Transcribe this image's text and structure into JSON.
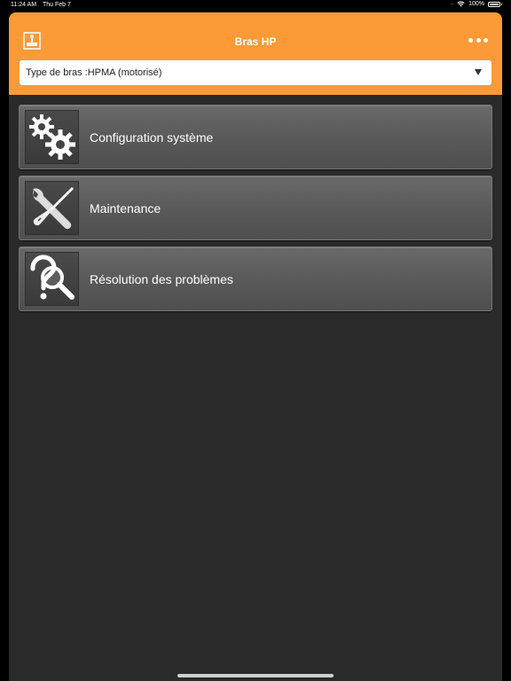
{
  "status_bar": {
    "time": "11:24 AM",
    "date": "Thu Feb 7",
    "battery": "100%"
  },
  "header": {
    "title": "Bras HP",
    "background_color": "#fb9a37"
  },
  "arm_type_select": {
    "value": "Type de bras :HPMA (motorisé)"
  },
  "menu": {
    "items": [
      {
        "label": "Configuration système",
        "icon": "gears-icon"
      },
      {
        "label": "Maintenance",
        "icon": "tools-icon"
      },
      {
        "label": "Résolution des problèmes",
        "icon": "troubleshoot-icon"
      }
    ]
  }
}
